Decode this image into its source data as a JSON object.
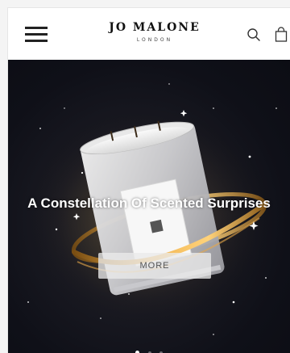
{
  "header": {
    "brand_name": "JO MALONE",
    "brand_subtitle": "LONDON",
    "icons": [
      "menu-icon",
      "search-icon",
      "shopping-bag-icon"
    ]
  },
  "hero": {
    "title": "A Constellation Of Scented Surprises",
    "cta_label": "MORE",
    "slides_total": 3,
    "active_slide": 1
  },
  "colors": {
    "hero_background": "#0f1018",
    "accent_gold": "#e0a640",
    "text_white": "#ffffff"
  }
}
